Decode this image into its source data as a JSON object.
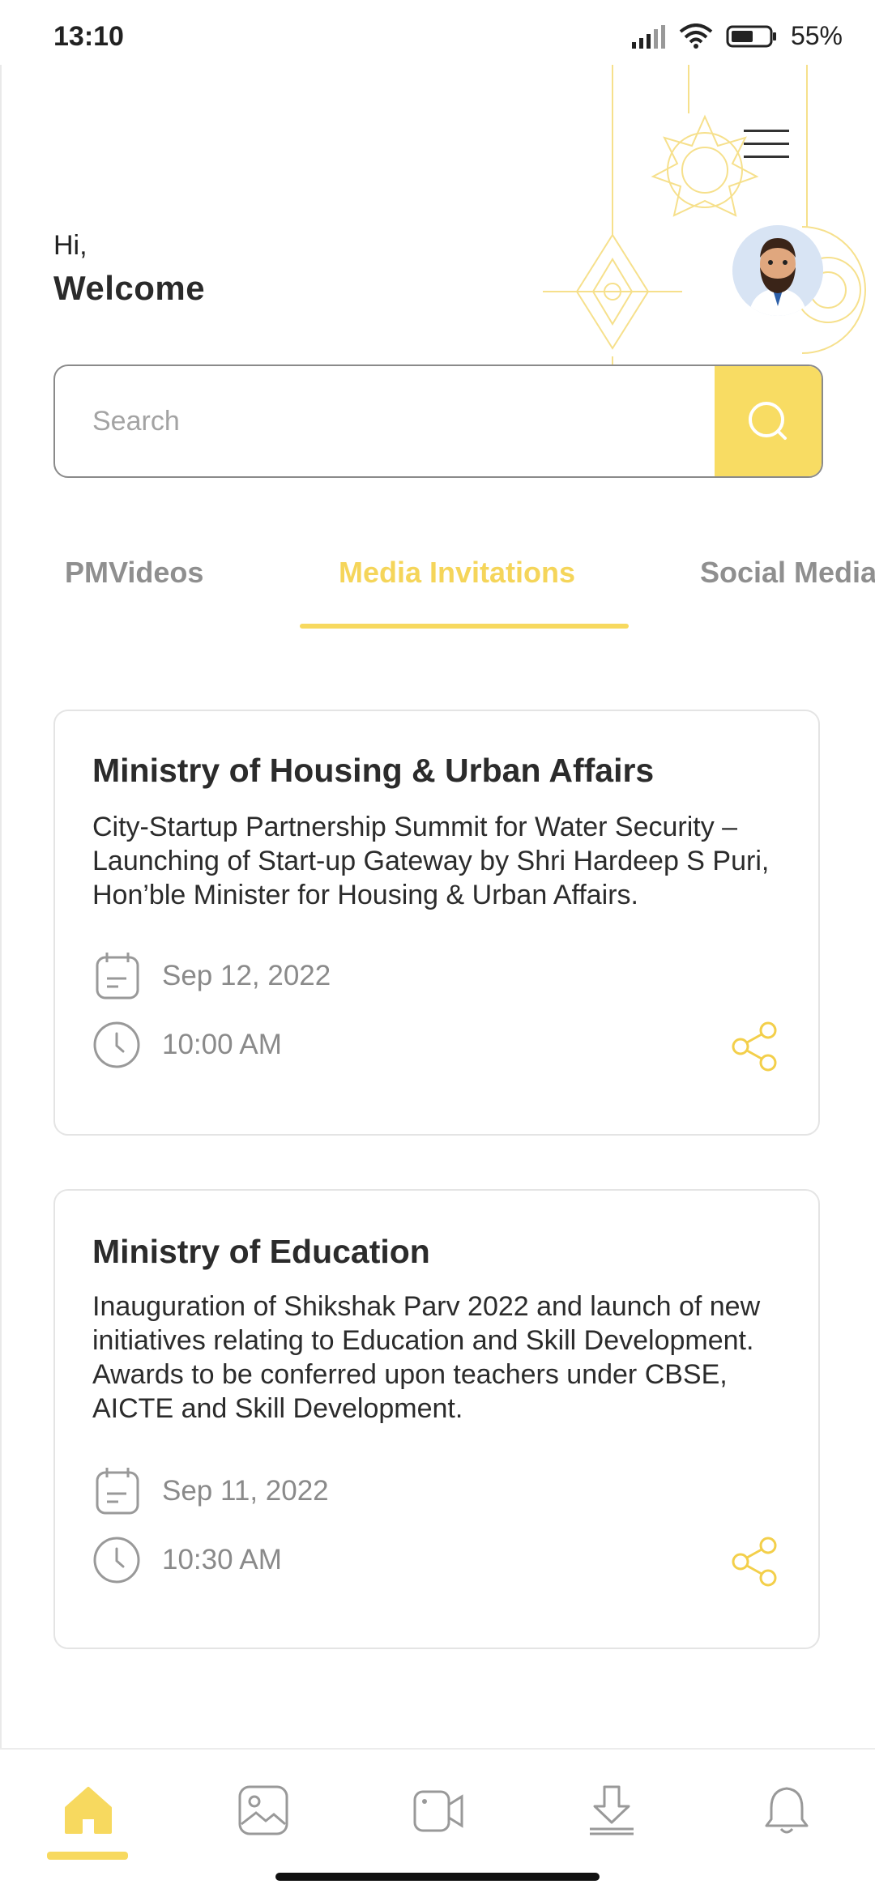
{
  "status_bar": {
    "time": "13:10",
    "battery": "55%"
  },
  "greeting": {
    "hi": "Hi,",
    "welcome": "Welcome"
  },
  "search": {
    "placeholder": "Search"
  },
  "tabs": [
    {
      "label": "PMVideos"
    },
    {
      "label": "Media Invitations",
      "active": true
    },
    {
      "label": "Social Media"
    }
  ],
  "cards": [
    {
      "title": "Ministry of Housing & Urban Affairs",
      "description": "City-Startup Partnership Summit for Water Security – Launching of Start-up Gateway by Shri Hardeep S Puri, Hon’ble Minister for  Housing & Urban Affairs.",
      "date": "Sep 12, 2022",
      "time": "10:00 AM"
    },
    {
      "title": "Ministry of Education",
      "description": "Inauguration of Shikshak Parv 2022 and launch of new initiatives relating to Education and Skill Development.  Awards to be conferred upon teachers under CBSE, AICTE and Skill Development.",
      "date": "Sep 11, 2022",
      "time": "10:30 AM"
    }
  ],
  "bottom_nav": [
    {
      "icon": "home-icon",
      "active": true
    },
    {
      "icon": "gallery-icon"
    },
    {
      "icon": "video-icon"
    },
    {
      "icon": "download-icon"
    },
    {
      "icon": "bell-icon"
    }
  ],
  "colors": {
    "accent": "#f7d95f",
    "text": "#2b2b2b",
    "muted": "#8f8f8f"
  }
}
